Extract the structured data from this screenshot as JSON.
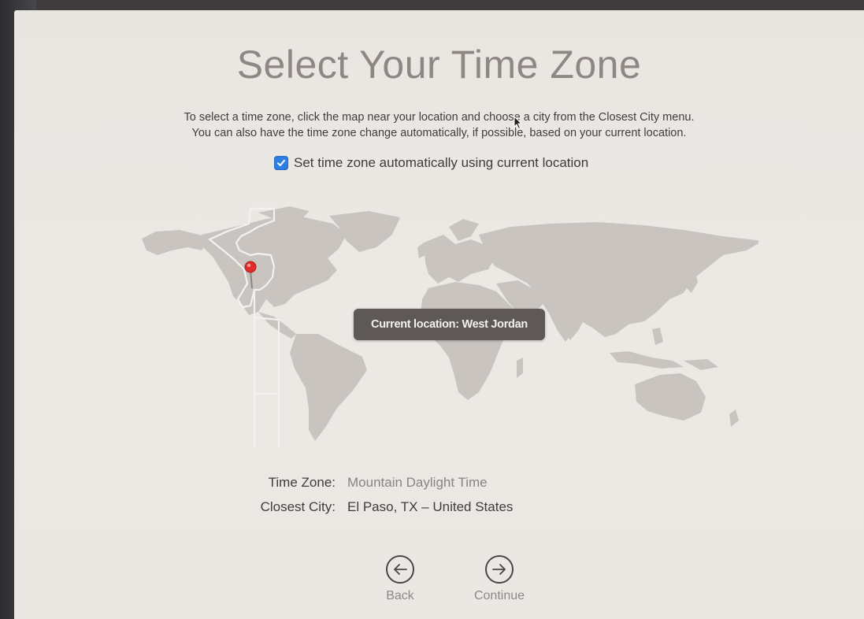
{
  "title": "Select Your Time Zone",
  "instructions": {
    "line1": "To select a time zone, click the map near your location and choose a city from the Closest City menu.",
    "line2": "You can also have the time zone change automatically, if possible, based on your current location."
  },
  "auto_timezone": {
    "label": "Set time zone automatically using current location",
    "checked": true
  },
  "map": {
    "tooltip": "Current location: West Jordan",
    "pin_color": "#e02b2b"
  },
  "info": {
    "timezone_label": "Time Zone:",
    "timezone_value": "Mountain Daylight Time",
    "city_label": "Closest City:",
    "city_value": "El Paso, TX – United States"
  },
  "nav": {
    "back_label": "Back",
    "back_icon": "arrow-left-circle-icon",
    "continue_label": "Continue",
    "continue_icon": "arrow-right-circle-icon"
  },
  "colors": {
    "accent": "#2f7ee4",
    "land": "#c9c3bf",
    "background": "#ebe8e4"
  }
}
